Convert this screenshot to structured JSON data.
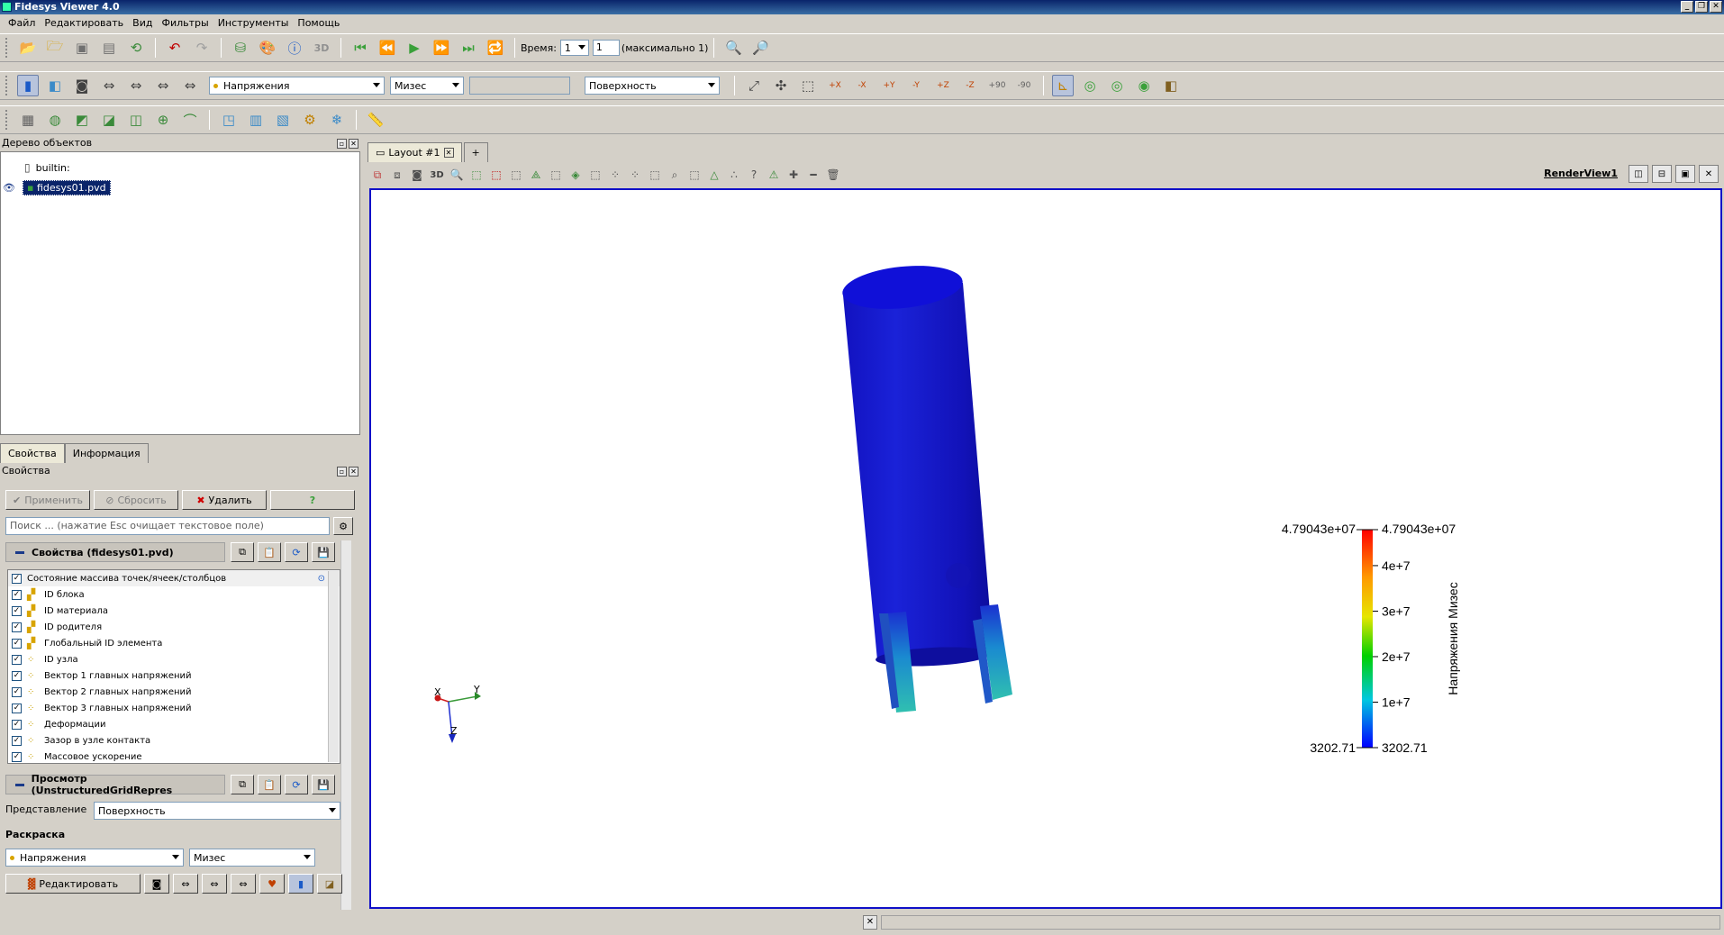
{
  "window": {
    "title": "Fidesys Viewer 4.0",
    "controls": [
      "_",
      "❐",
      "✕"
    ]
  },
  "menu": [
    "Файл",
    "Редактировать",
    "Вид",
    "Фильтры",
    "Инструменты",
    "Помощь"
  ],
  "toolbar1": {
    "time_label": "Время:",
    "time_value": "1",
    "step_value": "1",
    "max_label": "(максимально 1)",
    "icon_3d": "3D"
  },
  "toolbar2": {
    "color_by": "Напряжения",
    "component": "Мизес",
    "blank": "",
    "representation": "Поверхность",
    "camera_labels": [
      "+X",
      "-X",
      "+Y",
      "-Y",
      "+Z",
      "-Z",
      "+90",
      "-90"
    ]
  },
  "object_tree": {
    "title": "Дерево объектов",
    "items": [
      {
        "label": "builtin:"
      },
      {
        "label": "fidesys01.pvd"
      }
    ]
  },
  "left_tabs": [
    "Свойства",
    "Информация"
  ],
  "properties": {
    "title": "Свойства",
    "apply": "Применить",
    "reset": "Сбросить",
    "delete": "Удалить",
    "help": "?",
    "search_placeholder": "Поиск ... (нажатие Esc очищает текстовое поле)",
    "section1": "Свойства (fidesys01.pvd)",
    "array_header": "Состояние массива точек/ячеек/столбцов",
    "arrays": [
      {
        "label": "ID блока",
        "kind": "cell"
      },
      {
        "label": "ID материала",
        "kind": "cell"
      },
      {
        "label": "ID родителя",
        "kind": "cell"
      },
      {
        "label": "Глобальный ID элемента",
        "kind": "cell"
      },
      {
        "label": "ID узла",
        "kind": "point"
      },
      {
        "label": "Вектор 1 главных напряжений",
        "kind": "point"
      },
      {
        "label": "Вектор 2 главных напряжений",
        "kind": "point"
      },
      {
        "label": "Вектор 3 главных напряжений",
        "kind": "point"
      },
      {
        "label": "Деформации",
        "kind": "point"
      },
      {
        "label": "Зазор в узле контакта",
        "kind": "point"
      },
      {
        "label": "Массовое ускорение",
        "kind": "point"
      }
    ],
    "section2": "Просмотр (UnstructuredGridRepres",
    "representation_label": "Представление",
    "representation_value": "Поверхность",
    "coloring_label": "Раскраска",
    "coloring_array": "Напряжения",
    "coloring_component": "Мизес",
    "edit_button": "Редактировать"
  },
  "view": {
    "tab_label": "Layout #1",
    "add_tab": "+",
    "view_name": "RenderView1",
    "toolbar_3d": "3D"
  },
  "legend": {
    "title": "Напряжения Мизес",
    "max_left": "4.79043e+07",
    "max_right": "4.79043e+07",
    "min_left": "3202.71",
    "min_right": "3202.71",
    "ticks": [
      "4e+7",
      "3e+7",
      "2e+7",
      "1e+7"
    ],
    "tick_values": [
      40000000,
      30000000,
      20000000,
      10000000
    ],
    "range": [
      3202.71,
      47904300
    ]
  },
  "axes": {
    "x": "X",
    "y": "Y",
    "z": "Z"
  },
  "colors": {
    "accent": "#0a246a",
    "model": "#1a1ad2",
    "border": "#1010c8"
  }
}
